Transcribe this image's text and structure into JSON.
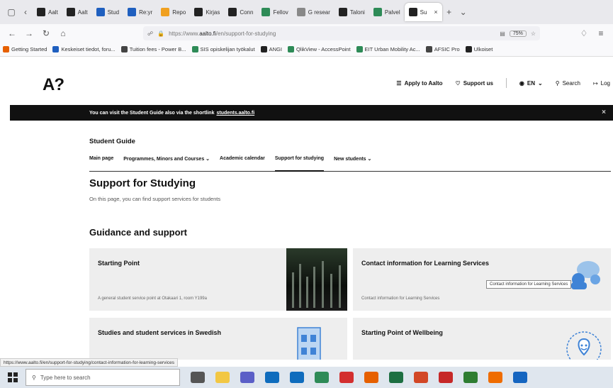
{
  "browser": {
    "tabs": [
      {
        "label": "Aalt",
        "icon": "aalto-favicon",
        "color": "#222222"
      },
      {
        "label": "Aalt",
        "icon": "aalto-favicon",
        "color": "#222222"
      },
      {
        "label": "Stud",
        "icon": "doc-favicon",
        "color": "#1f5fbf"
      },
      {
        "label": "Re:yr",
        "icon": "outlook-favicon",
        "color": "#1f5fbf"
      },
      {
        "label": "Repo",
        "icon": "orange-favicon",
        "color": "#f0a020"
      },
      {
        "label": "Kirjas",
        "icon": "aalto-favicon",
        "color": "#222222"
      },
      {
        "label": "Conn",
        "icon": "aalto-favicon",
        "color": "#222222"
      },
      {
        "label": "Fellov",
        "icon": "green-favicon",
        "color": "#2e8b57"
      },
      {
        "label": "G resear",
        "icon": "google-favicon",
        "color": "#888888"
      },
      {
        "label": "Taloni",
        "icon": "aalto-favicon",
        "color": "#222222"
      },
      {
        "label": "Palvel",
        "icon": "green-favicon",
        "color": "#2e8b57"
      },
      {
        "label": "Su",
        "icon": "aalto-favicon",
        "color": "#222222",
        "active": true
      }
    ],
    "url_prefix": "https://www.",
    "url_domain": "aalto.fi",
    "url_path": "/en/support-for-studying",
    "zoom": "75%",
    "bookmarks": [
      {
        "label": "Getting Started",
        "color": "#e66000"
      },
      {
        "label": "Keskeiset tiedot, foru...",
        "color": "#1f5fbf"
      },
      {
        "label": "Tuition fees - Power B...",
        "color": "#444444"
      },
      {
        "label": "SIS opiskelijan työkalut",
        "color": "#2e8b57"
      },
      {
        "label": "ANGI",
        "color": "#222222"
      },
      {
        "label": "QlikView - AccessPoint",
        "color": "#2e8b57"
      },
      {
        "label": "EIT Urban Mobility Ac...",
        "color": "#2e8b57"
      },
      {
        "label": "AFSIC Pro",
        "color": "#444444"
      },
      {
        "label": "Ulkoiset",
        "color": "#222222"
      }
    ],
    "status_url": "https://www.aalto.fi/en/support-for-studying/contact-information-for-learning-services"
  },
  "site": {
    "logo": "A?",
    "topnav": {
      "apply": "Apply to Aalto",
      "support": "Support us",
      "lang": "EN",
      "search": "Search",
      "login": "Log"
    },
    "notice": {
      "text": "You can visit the Student Guide also via the shortlink",
      "link": "students.aalto.fi"
    },
    "section_title": "Student Guide",
    "subnav": [
      {
        "label": "Main page"
      },
      {
        "label": "Programmes, Minors and Courses ⌄"
      },
      {
        "label": "Academic calendar"
      },
      {
        "label": "Support for studying",
        "active": true
      },
      {
        "label": "New students ⌄"
      }
    ],
    "page_title": "Support for Studying",
    "intro": "On this page, you can find support services for students",
    "guidance_title": "Guidance and support",
    "cards": [
      {
        "title": "Starting Point",
        "desc": "A general student service point at Otakaari 1, room Y199a"
      },
      {
        "title": "Contact information for Learning Services",
        "desc": "Contact information for Learning Services"
      },
      {
        "title": "Studies and student services in Swedish",
        "desc": ""
      },
      {
        "title": "Starting Point of Wellbeing",
        "desc": ""
      }
    ],
    "tooltip": "Contact information for Learning Services"
  },
  "taskbar": {
    "search_placeholder": "Type here to search",
    "apps": [
      {
        "name": "task-view",
        "color": "#555555"
      },
      {
        "name": "file-explorer",
        "color": "#f2c744"
      },
      {
        "name": "teams",
        "color": "#5b5fc7"
      },
      {
        "name": "outlook",
        "color": "#0f6cbd"
      },
      {
        "name": "mail",
        "color": "#0f6cbd"
      },
      {
        "name": "chrome",
        "color": "#2e8b57"
      },
      {
        "name": "acrobat",
        "color": "#d32f2f"
      },
      {
        "name": "firefox",
        "color": "#e66000"
      },
      {
        "name": "excel",
        "color": "#1d6f42"
      },
      {
        "name": "powerpoint",
        "color": "#d24726"
      },
      {
        "name": "app-red",
        "color": "#c62828"
      },
      {
        "name": "app-green",
        "color": "#2e7d32"
      },
      {
        "name": "app-orange",
        "color": "#ef6c00"
      },
      {
        "name": "app-blue",
        "color": "#1565c0"
      }
    ]
  }
}
